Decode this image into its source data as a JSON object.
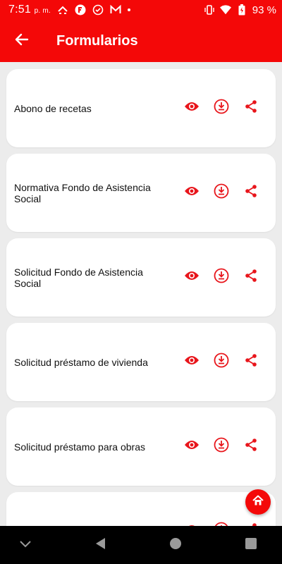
{
  "status_bar": {
    "time": "7:51",
    "time_suffix": "p. m.",
    "battery_percent": "93 %",
    "icons": [
      "missed-call-icon",
      "f-app-icon",
      "check-circle-icon",
      "gmail-icon",
      "notification-dot-icon",
      "vibrate-icon",
      "wifi-icon",
      "battery-icon"
    ]
  },
  "appbar": {
    "title": "Formularios",
    "back_icon": "arrow-back-icon"
  },
  "forms": [
    {
      "title": "Abono de recetas"
    },
    {
      "title": "Normativa Fondo de Asistencia Social"
    },
    {
      "title": "Solicitud Fondo de Asistencia Social"
    },
    {
      "title": "Solicitud préstamo de vivienda"
    },
    {
      "title": "Solicitud préstamo para obras"
    },
    {
      "title": ""
    }
  ],
  "card_actions": [
    "eye-icon",
    "download-icon",
    "share-icon"
  ],
  "fab": {
    "icon": "home-icon"
  },
  "navbar": {
    "icons": [
      "chevron-down-icon",
      "back-triangle-icon",
      "home-circle-icon",
      "recents-square-icon"
    ]
  },
  "colors": {
    "primary": "#f40808",
    "background": "#ececec",
    "card": "#ffffff",
    "icon_red": "#e8151b"
  }
}
